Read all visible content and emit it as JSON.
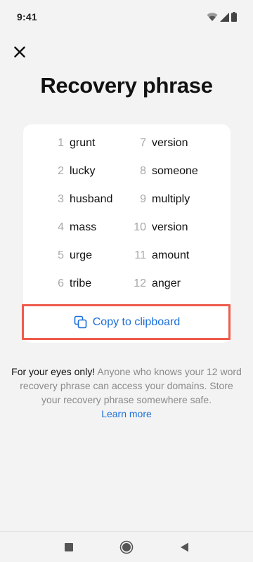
{
  "status_bar": {
    "time": "9:41"
  },
  "title": "Recovery phrase",
  "phrase": [
    {
      "num": "1",
      "word": "grunt"
    },
    {
      "num": "2",
      "word": "lucky"
    },
    {
      "num": "3",
      "word": "husband"
    },
    {
      "num": "4",
      "word": "mass"
    },
    {
      "num": "5",
      "word": "urge"
    },
    {
      "num": "6",
      "word": "tribe"
    },
    {
      "num": "7",
      "word": "version"
    },
    {
      "num": "8",
      "word": "someone"
    },
    {
      "num": "9",
      "word": "multiply"
    },
    {
      "num": "10",
      "word": "version"
    },
    {
      "num": "11",
      "word": "amount"
    },
    {
      "num": "12",
      "word": "anger"
    }
  ],
  "copy_button": {
    "label": "Copy to clipboard",
    "icon": "copy-icon"
  },
  "warning": {
    "bold": "For your eyes only!",
    "text": "Anyone who knows your 12 word recovery phrase can access your domains. Store your recovery phrase somewhere safe.",
    "link": "Learn more"
  },
  "colors": {
    "accent": "#1a6ed8",
    "highlight": "#ef5b4c",
    "background": "#f3f3f3"
  }
}
